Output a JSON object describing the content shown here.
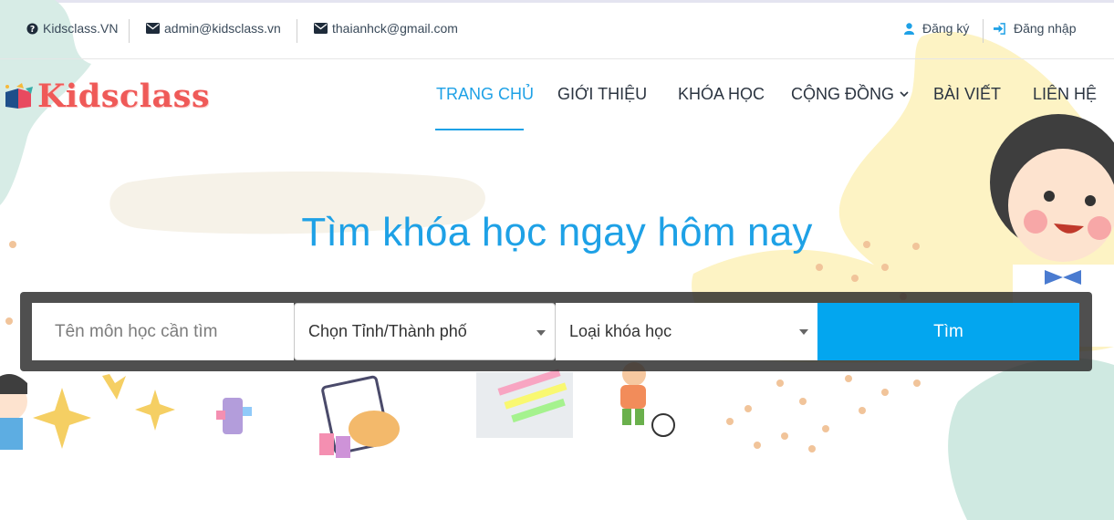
{
  "topbar": {
    "site_name": "Kidsclass.VN",
    "email_admin": "admin@kidsclass.vn",
    "email_contact": "thaianhck@gmail.com",
    "register_label": "Đăng ký",
    "login_label": "Đăng nhập",
    "icons": [
      "question-circle-icon",
      "envelope-icon",
      "user-icon",
      "sign-in-icon"
    ]
  },
  "logo": {
    "text": "Kidsclass"
  },
  "nav": {
    "items": [
      {
        "label": "TRANG CHỦ",
        "active": true
      },
      {
        "label": "GIỚI THIỆU"
      },
      {
        "label": "KHÓA HỌC"
      },
      {
        "label": "CỘNG ĐỒNG",
        "has_dropdown": true
      },
      {
        "label": "BÀI VIẾT"
      },
      {
        "label": "LIÊN HỆ"
      }
    ]
  },
  "hero": {
    "title": "Tìm khóa học ngay hôm nay"
  },
  "search": {
    "subject_placeholder": "Tên môn học cần tìm",
    "province_selected": "Chọn Tỉnh/Thành phố",
    "course_type_selected": "Loại khóa học",
    "button_label": "Tìm"
  },
  "colors": {
    "accent": "#1ea1e6",
    "button": "#03a6ef",
    "logo": "#ef5a58",
    "blob_yellow": "#fdf3c4",
    "blob_mint": "#cfe9e1"
  }
}
